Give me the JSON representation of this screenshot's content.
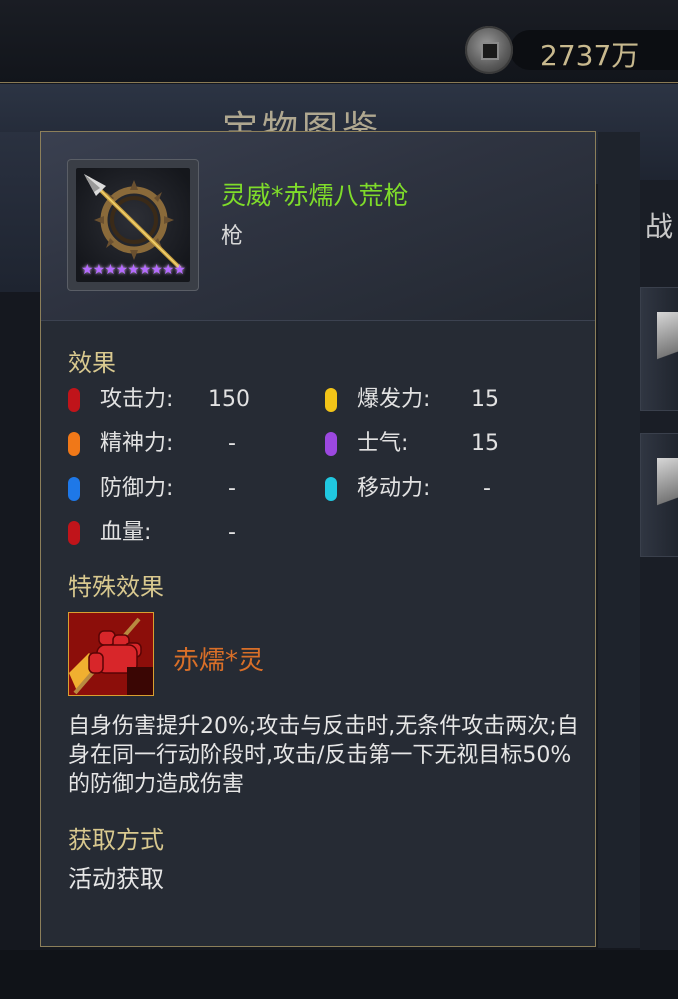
{
  "currency": {
    "value": "2737万",
    "icon": "coin-icon"
  },
  "background": {
    "title": "宝物图鉴",
    "tab_label": "战"
  },
  "item": {
    "name": "灵威*赤燸八荒枪",
    "type": "枪",
    "stars": "★★★★★★★★★",
    "star_color": "#b56bff",
    "name_color": "#7fdc2a"
  },
  "effects": {
    "title": "效果",
    "stats": [
      {
        "label": "攻击力:",
        "value": "150",
        "color": "#c0141a"
      },
      {
        "label": "爆发力:",
        "value": "15",
        "color": "#f2c418"
      },
      {
        "label": "精神力:",
        "value": "-",
        "color": "#f07818"
      },
      {
        "label": "士气:",
        "value": "15",
        "color": "#9c48e0"
      },
      {
        "label": "防御力:",
        "value": "-",
        "color": "#1e78e8"
      },
      {
        "label": "移动力:",
        "value": "-",
        "color": "#20c8e0"
      },
      {
        "label": "血量:",
        "value": "-",
        "color": "#c0141a"
      }
    ]
  },
  "special": {
    "title": "特殊效果",
    "skill_name": "赤燸*灵",
    "skill_icon": "fist-icon",
    "description": "自身伤害提升20%;攻击与反击时,无条件攻击两次;自身在同一行动阶段时,攻击/反击第一下无视目标50%的防御力造成伤害"
  },
  "acquire": {
    "title": "获取方式",
    "method": "活动获取"
  }
}
